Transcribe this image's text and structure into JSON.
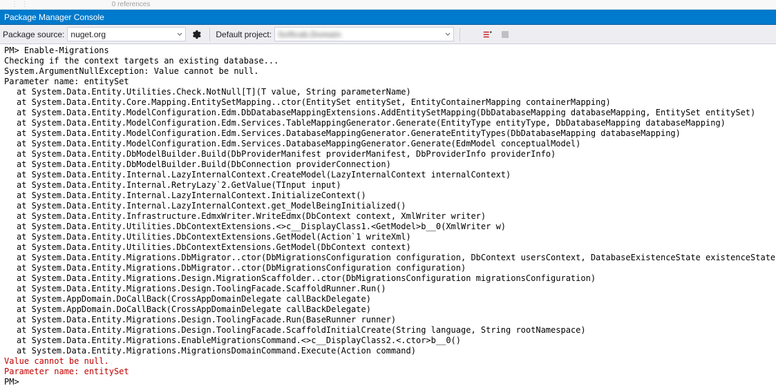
{
  "top": {
    "references": "0 references"
  },
  "title": "Package Manager Console",
  "toolbar": {
    "package_source_label": "Package source:",
    "package_source_value": "nuget.org",
    "default_project_label": "Default project:",
    "default_project_value": "Softcab.Domain"
  },
  "console": {
    "prompt": "PM>",
    "command": "Enable-Migrations",
    "line_checking": "Checking if the context targets an existing database...",
    "line_exception": "System.ArgumentNullException: Value cannot be null.",
    "line_param": "Parameter name: entitySet",
    "stack": [
      "at System.Data.Entity.Utilities.Check.NotNull[T](T value, String parameterName)",
      "at System.Data.Entity.Core.Mapping.EntitySetMapping..ctor(EntitySet entitySet, EntityContainerMapping containerMapping)",
      "at System.Data.Entity.ModelConfiguration.Edm.DbDatabaseMappingExtensions.AddEntitySetMapping(DbDatabaseMapping databaseMapping, EntitySet entitySet)",
      "at System.Data.Entity.ModelConfiguration.Edm.Services.TableMappingGenerator.Generate(EntityType entityType, DbDatabaseMapping databaseMapping)",
      "at System.Data.Entity.ModelConfiguration.Edm.Services.DatabaseMappingGenerator.GenerateEntityTypes(DbDatabaseMapping databaseMapping)",
      "at System.Data.Entity.ModelConfiguration.Edm.Services.DatabaseMappingGenerator.Generate(EdmModel conceptualModel)",
      "at System.Data.Entity.DbModelBuilder.Build(DbProviderManifest providerManifest, DbProviderInfo providerInfo)",
      "at System.Data.Entity.DbModelBuilder.Build(DbConnection providerConnection)",
      "at System.Data.Entity.Internal.LazyInternalContext.CreateModel(LazyInternalContext internalContext)",
      "at System.Data.Entity.Internal.RetryLazy`2.GetValue(TInput input)",
      "at System.Data.Entity.Internal.LazyInternalContext.InitializeContext()",
      "at System.Data.Entity.Internal.LazyInternalContext.get_ModelBeingInitialized()",
      "at System.Data.Entity.Infrastructure.EdmxWriter.WriteEdmx(DbContext context, XmlWriter writer)",
      "at System.Data.Entity.Utilities.DbContextExtensions.<>c__DisplayClass1.<GetModel>b__0(XmlWriter w)",
      "at System.Data.Entity.Utilities.DbContextExtensions.GetModel(Action`1 writeXml)",
      "at System.Data.Entity.Utilities.DbContextExtensions.GetModel(DbContext context)",
      "at System.Data.Entity.Migrations.DbMigrator..ctor(DbMigrationsConfiguration configuration, DbContext usersContext, DatabaseExistenceState existenceState)",
      "at System.Data.Entity.Migrations.DbMigrator..ctor(DbMigrationsConfiguration configuration)",
      "at System.Data.Entity.Migrations.Design.MigrationScaffolder..ctor(DbMigrationsConfiguration migrationsConfiguration)",
      "at System.Data.Entity.Migrations.Design.ToolingFacade.ScaffoldRunner.Run()",
      "at System.AppDomain.DoCallBack(CrossAppDomainDelegate callBackDelegate)",
      "at System.AppDomain.DoCallBack(CrossAppDomainDelegate callBackDelegate)",
      "at System.Data.Entity.Migrations.Design.ToolingFacade.Run(BaseRunner runner)",
      "at System.Data.Entity.Migrations.Design.ToolingFacade.ScaffoldInitialCreate(String language, String rootNamespace)",
      "at System.Data.Entity.Migrations.EnableMigrationsCommand.<>c__DisplayClass2.<.ctor>b__0()",
      "at System.Data.Entity.Migrations.MigrationsDomainCommand.Execute(Action command)"
    ],
    "error_line1": "Value cannot be null.",
    "error_line2": "Parameter name: entitySet",
    "final_prompt": "PM>"
  }
}
